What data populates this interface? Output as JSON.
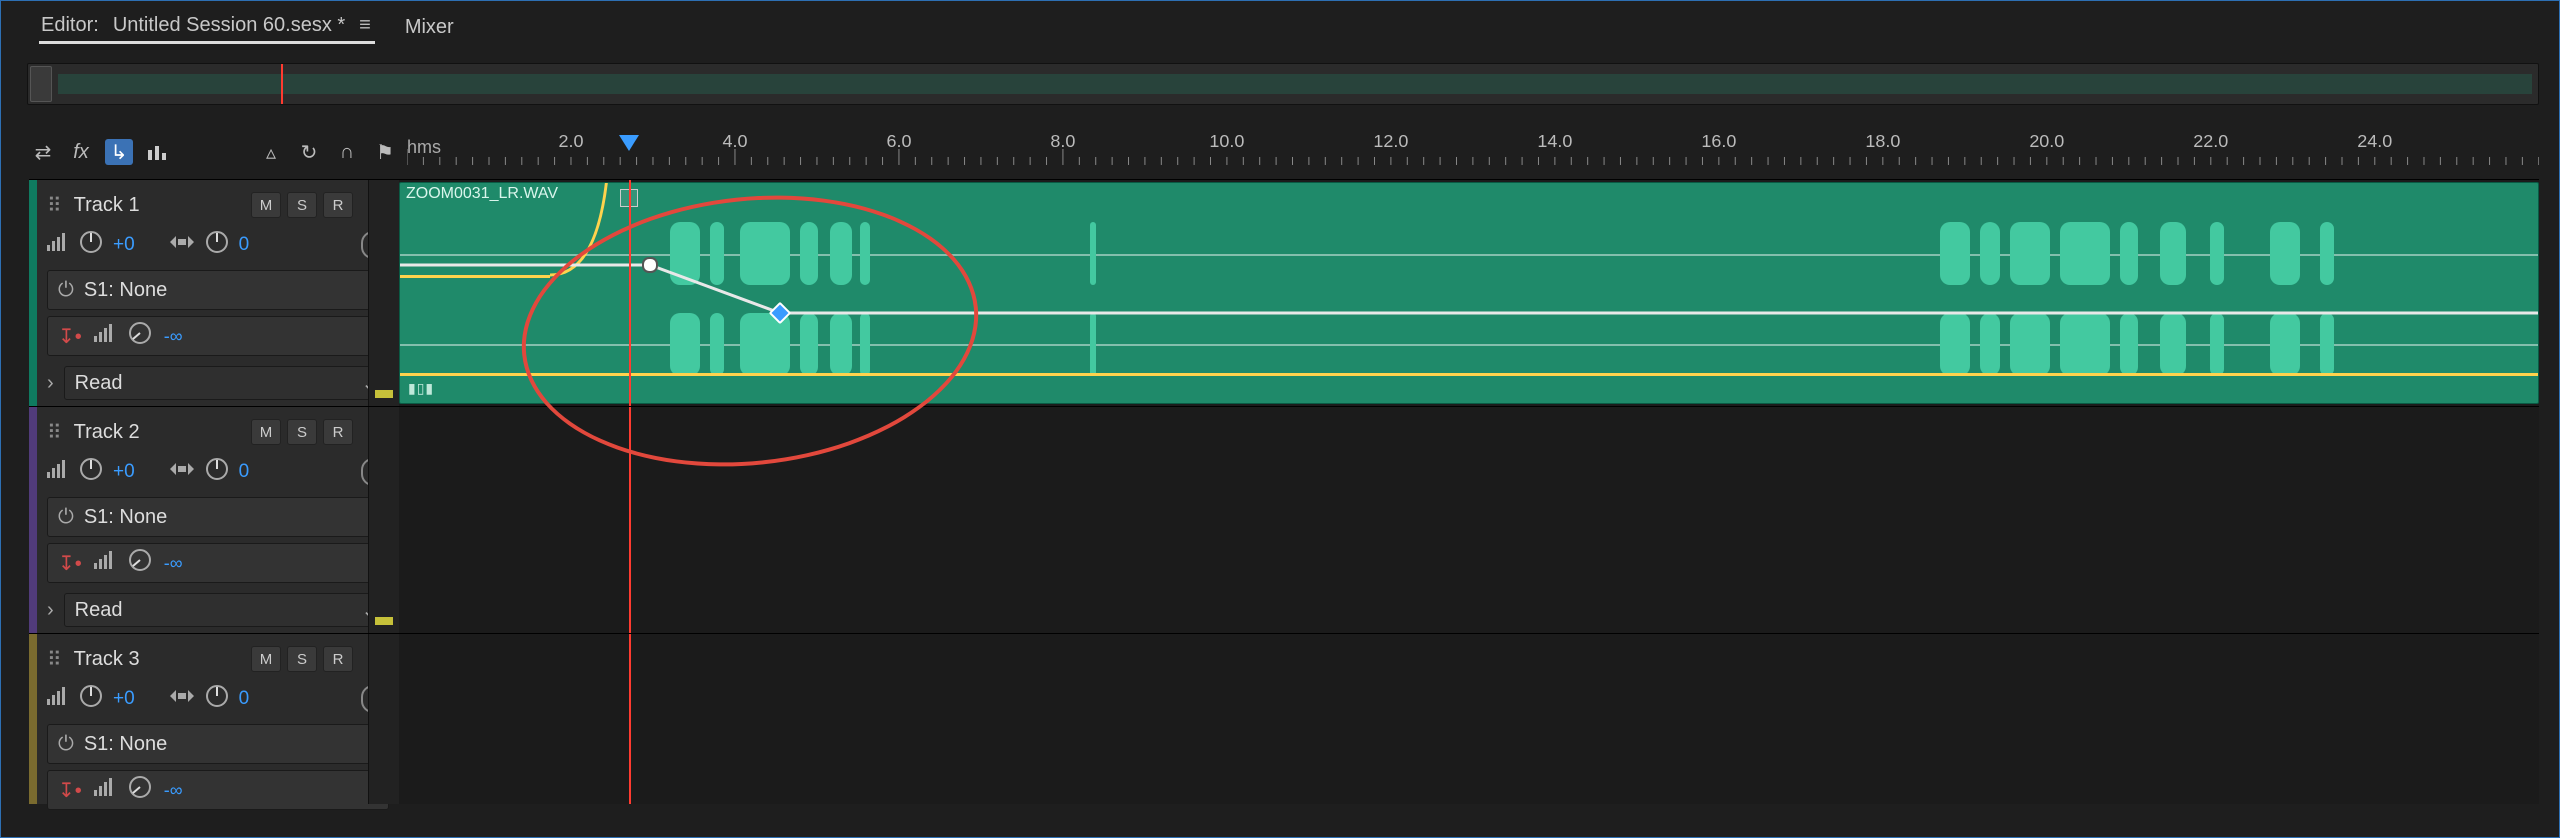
{
  "tabs": {
    "editor_prefix": "Editor:",
    "session": "Untitled Session 60.sesx *",
    "mixer": "Mixer"
  },
  "ruler": {
    "unit": "hms",
    "ticks": [
      "2.0",
      "4.0",
      "6.0",
      "8.0",
      "10.0",
      "12.0",
      "14.0",
      "16.0",
      "18.0",
      "20.0",
      "22.0",
      "24.0"
    ],
    "start": 0,
    "end": 26.0,
    "playhead": 2.7
  },
  "clip": {
    "name": "ZOOM0031_LR.WAV"
  },
  "tracks": [
    {
      "name": "Track 1",
      "color": "#0f7a60",
      "vol": "+0",
      "pan": "0",
      "fx_slot": "S1: None",
      "send": "-∞",
      "automation": "Read",
      "m": "M",
      "s": "S",
      "r": "R"
    },
    {
      "name": "Track 2",
      "color": "#513b7a",
      "vol": "+0",
      "pan": "0",
      "fx_slot": "S1: None",
      "send": "-∞",
      "automation": "Read",
      "m": "M",
      "s": "S",
      "r": "R"
    },
    {
      "name": "Track 3",
      "color": "#7a6b2f",
      "vol": "+0",
      "pan": "0",
      "fx_slot": "S1: None",
      "send": "-∞",
      "automation": "",
      "m": "M",
      "s": "S",
      "r": "R"
    }
  ],
  "icons": {
    "levels": "▮▯▮"
  },
  "annotation": {
    "note": "red ellipse highlighting automation keyframes near 2–6s"
  }
}
